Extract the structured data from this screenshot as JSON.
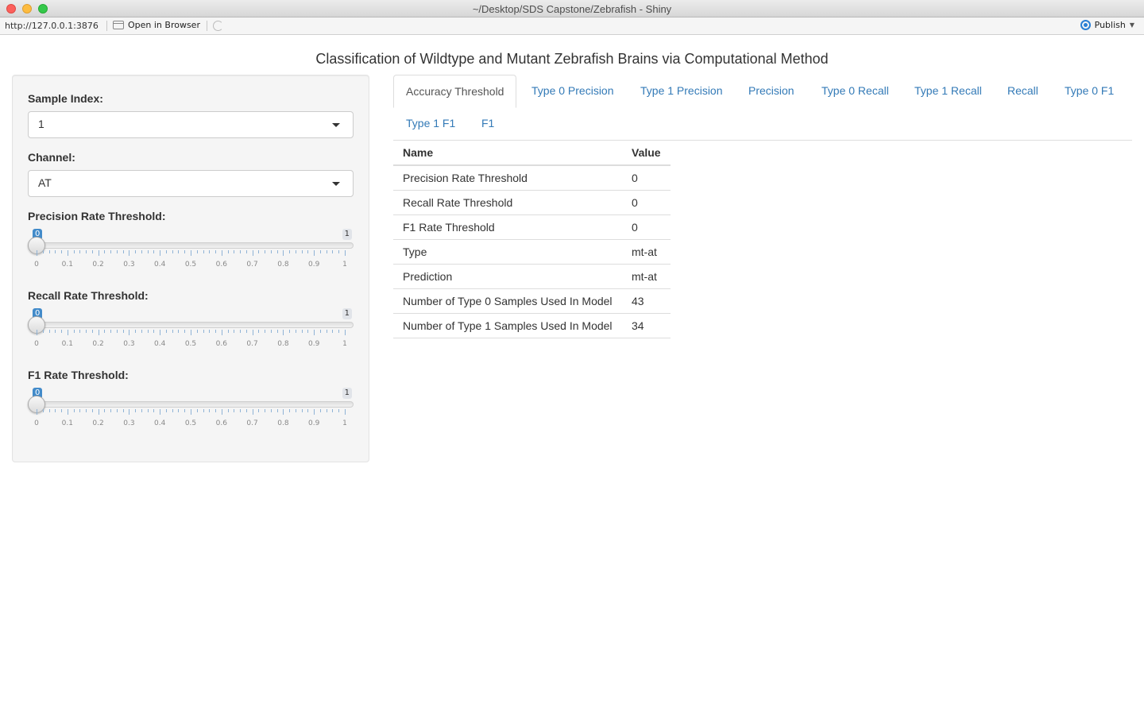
{
  "window": {
    "title": "~/Desktop/SDS Capstone/Zebrafish - Shiny"
  },
  "toolbar": {
    "url": "http://127.0.0.1:3876",
    "open_in_browser": "Open in Browser",
    "publish": "Publish"
  },
  "app": {
    "title": "Classification of Wildtype and Mutant Zebrafish Brains via Computational Method"
  },
  "sidebar": {
    "sample_index": {
      "label": "Sample Index:",
      "value": "1"
    },
    "channel": {
      "label": "Channel:",
      "value": "AT"
    },
    "sliders": [
      {
        "label": "Precision Rate Threshold:",
        "value": "0",
        "min": "0",
        "max": "1",
        "ticks": [
          "0",
          "0.1",
          "0.2",
          "0.3",
          "0.4",
          "0.5",
          "0.6",
          "0.7",
          "0.8",
          "0.9",
          "1"
        ]
      },
      {
        "label": "Recall Rate Threshold:",
        "value": "0",
        "min": "0",
        "max": "1",
        "ticks": [
          "0",
          "0.1",
          "0.2",
          "0.3",
          "0.4",
          "0.5",
          "0.6",
          "0.7",
          "0.8",
          "0.9",
          "1"
        ]
      },
      {
        "label": "F1 Rate Threshold:",
        "value": "0",
        "min": "0",
        "max": "1",
        "ticks": [
          "0",
          "0.1",
          "0.2",
          "0.3",
          "0.4",
          "0.5",
          "0.6",
          "0.7",
          "0.8",
          "0.9",
          "1"
        ]
      }
    ]
  },
  "tabs": [
    {
      "label": "Accuracy Threshold",
      "active": true
    },
    {
      "label": "Type 0 Precision",
      "active": false
    },
    {
      "label": "Type 1 Precision",
      "active": false
    },
    {
      "label": "Precision",
      "active": false
    },
    {
      "label": "Type 0 Recall",
      "active": false
    },
    {
      "label": "Type 1 Recall",
      "active": false
    },
    {
      "label": "Recall",
      "active": false
    },
    {
      "label": "Type 0 F1",
      "active": false
    },
    {
      "label": "Type 1 F1",
      "active": false
    },
    {
      "label": "F1",
      "active": false
    }
  ],
  "table": {
    "headers": [
      "Name",
      "Value"
    ],
    "rows": [
      [
        "Precision Rate Threshold",
        "0"
      ],
      [
        "Recall Rate Threshold",
        "0"
      ],
      [
        "F1 Rate Threshold",
        "0"
      ],
      [
        "Type",
        "mt-at"
      ],
      [
        "Prediction",
        "mt-at"
      ],
      [
        "Number of Type 0 Samples Used In Model",
        "43"
      ],
      [
        "Number of Type 1 Samples Used In Model",
        "34"
      ]
    ]
  }
}
